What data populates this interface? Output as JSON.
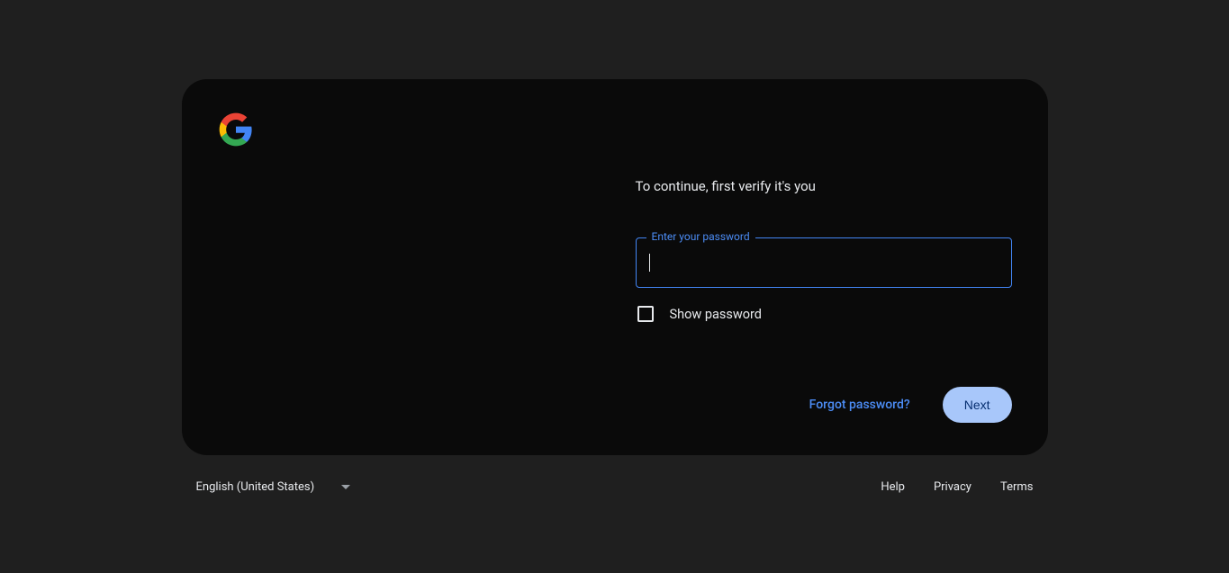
{
  "verify_text": "To continue, first verify it's you",
  "password_field": {
    "label": "Enter your password",
    "value": ""
  },
  "show_password_label": "Show password",
  "forgot_password_label": "Forgot password?",
  "next_button_label": "Next",
  "footer": {
    "language": "English (United States)",
    "links": {
      "help": "Help",
      "privacy": "Privacy",
      "terms": "Terms"
    }
  }
}
